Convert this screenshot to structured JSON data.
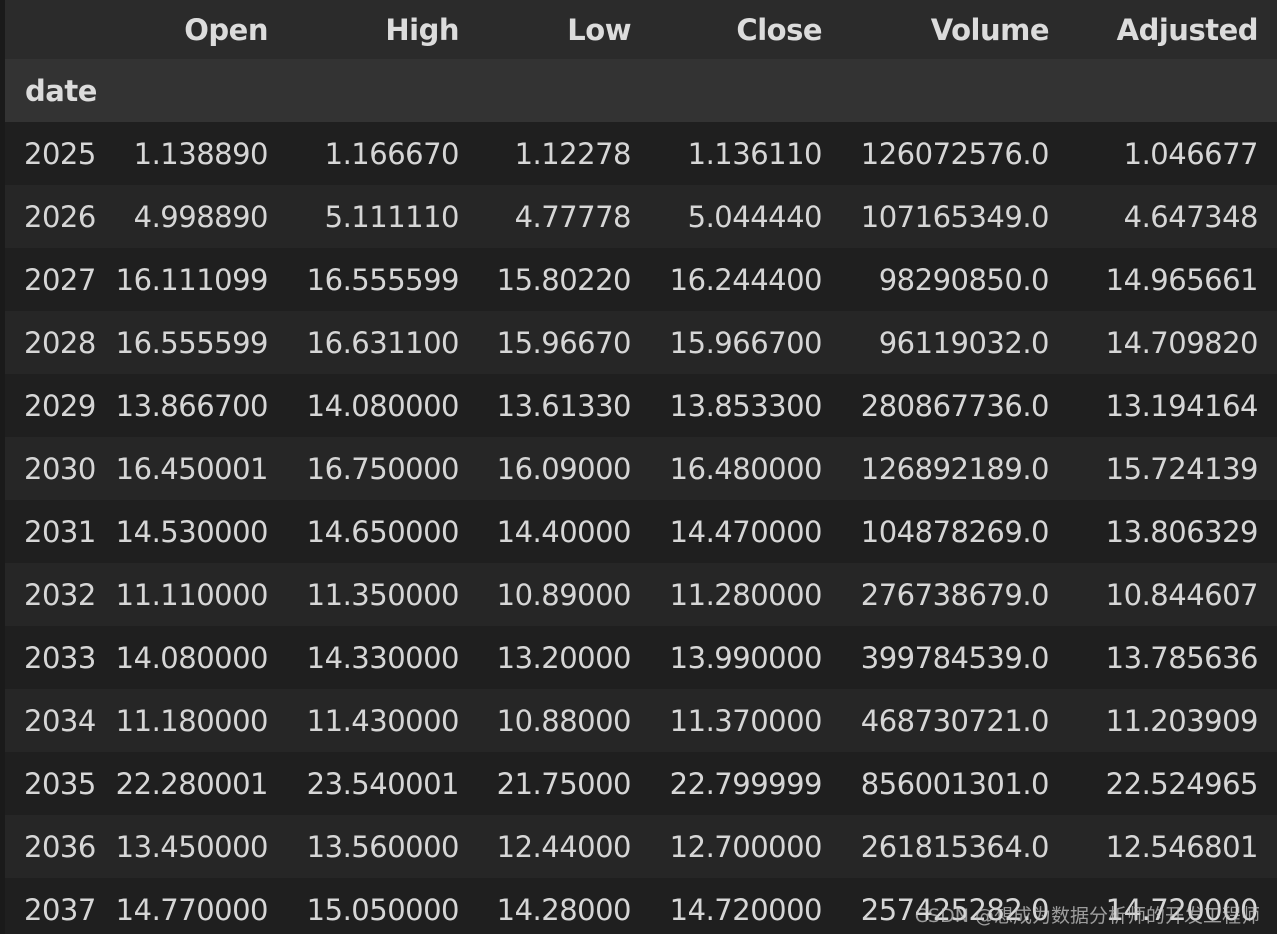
{
  "table": {
    "index_name": "date",
    "columns": [
      "Open",
      "High",
      "Low",
      "Close",
      "Volume",
      "Adjusted"
    ],
    "rows": [
      {
        "date": "2025",
        "values": [
          "1.138890",
          "1.166670",
          "1.12278",
          "1.136110",
          "126072576.0",
          "1.046677"
        ]
      },
      {
        "date": "2026",
        "values": [
          "4.998890",
          "5.111110",
          "4.77778",
          "5.044440",
          "107165349.0",
          "4.647348"
        ]
      },
      {
        "date": "2027",
        "values": [
          "16.111099",
          "16.555599",
          "15.80220",
          "16.244400",
          "98290850.0",
          "14.965661"
        ]
      },
      {
        "date": "2028",
        "values": [
          "16.555599",
          "16.631100",
          "15.96670",
          "15.966700",
          "96119032.0",
          "14.709820"
        ]
      },
      {
        "date": "2029",
        "values": [
          "13.866700",
          "14.080000",
          "13.61330",
          "13.853300",
          "280867736.0",
          "13.194164"
        ]
      },
      {
        "date": "2030",
        "values": [
          "16.450001",
          "16.750000",
          "16.09000",
          "16.480000",
          "126892189.0",
          "15.724139"
        ]
      },
      {
        "date": "2031",
        "values": [
          "14.530000",
          "14.650000",
          "14.40000",
          "14.470000",
          "104878269.0",
          "13.806329"
        ]
      },
      {
        "date": "2032",
        "values": [
          "11.110000",
          "11.350000",
          "10.89000",
          "11.280000",
          "276738679.0",
          "10.844607"
        ]
      },
      {
        "date": "2033",
        "values": [
          "14.080000",
          "14.330000",
          "13.20000",
          "13.990000",
          "399784539.0",
          "13.785636"
        ]
      },
      {
        "date": "2034",
        "values": [
          "11.180000",
          "11.430000",
          "10.88000",
          "11.370000",
          "468730721.0",
          "11.203909"
        ]
      },
      {
        "date": "2035",
        "values": [
          "22.280001",
          "23.540001",
          "21.75000",
          "22.799999",
          "856001301.0",
          "22.524965"
        ]
      },
      {
        "date": "2036",
        "values": [
          "13.450000",
          "13.560000",
          "12.44000",
          "12.700000",
          "261815364.0",
          "12.546801"
        ]
      },
      {
        "date": "2037",
        "values": [
          "14.770000",
          "15.050000",
          "14.28000",
          "14.720000",
          "257425282.0",
          "14.720000"
        ]
      }
    ]
  },
  "watermark": "CSDN @想成为数据分析师的开发工程师"
}
